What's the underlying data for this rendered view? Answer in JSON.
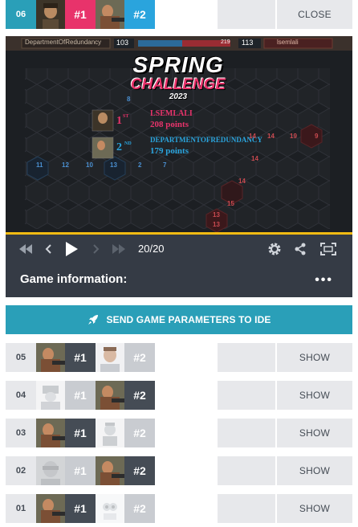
{
  "current_battle": {
    "index": "06",
    "player1_rank": "#1",
    "player2_rank": "#2",
    "action": "CLOSE"
  },
  "viewer": {
    "top_bar": {
      "left_player": "DepartmentOfRedundancy",
      "left_score": "103",
      "center_value": "219",
      "right_score": "113",
      "right_player": "lsemlali"
    },
    "logo_line1": "SPRING",
    "logo_line2": "CHALLENGE",
    "logo_year": "2023",
    "results": [
      {
        "place": "1",
        "suffix": "ST",
        "name": "LSEMLALI",
        "points": "208 points",
        "color": "#e8336b"
      },
      {
        "place": "2",
        "suffix": "ND",
        "name": "DEPARTMENTOFREDUNDANCY",
        "points": "179 points",
        "color": "#2aa4dd"
      }
    ],
    "hex_numbers": [
      "8",
      "14",
      "14",
      "19",
      "9",
      "14",
      "11",
      "12",
      "10",
      "13",
      "2",
      "7",
      "14",
      "15",
      "13",
      "13"
    ]
  },
  "player_controls": {
    "frame": "20/20",
    "icons": [
      "rewind-icon",
      "step-back-icon",
      "play-icon",
      "step-forward-icon",
      "fast-forward-icon",
      "settings-icon",
      "share-icon",
      "fullscreen-icon"
    ]
  },
  "game_info": {
    "title": "Game information:",
    "more": "•••"
  },
  "send_button": {
    "label": "SEND GAME PARAMETERS TO IDE",
    "icon": "rocket-icon"
  },
  "battles": [
    {
      "index": "05",
      "player1_rank": "#1",
      "player2_rank": "#2",
      "action": "SHOW"
    },
    {
      "index": "04",
      "player1_rank": "#1",
      "player2_rank": "#2",
      "action": "SHOW"
    },
    {
      "index": "03",
      "player1_rank": "#1",
      "player2_rank": "#2",
      "action": "SHOW"
    },
    {
      "index": "02",
      "player1_rank": "#1",
      "player2_rank": "#2",
      "action": "SHOW"
    },
    {
      "index": "01",
      "player1_rank": "#1",
      "player2_rank": "#2",
      "action": "SHOW"
    }
  ],
  "colors": {
    "accent": "#2a9fb8",
    "player1": "#e8336b",
    "player2": "#2aa4dd",
    "dark": "#454c55",
    "light": "#e7e8eb",
    "gold": "#f2bb13"
  }
}
